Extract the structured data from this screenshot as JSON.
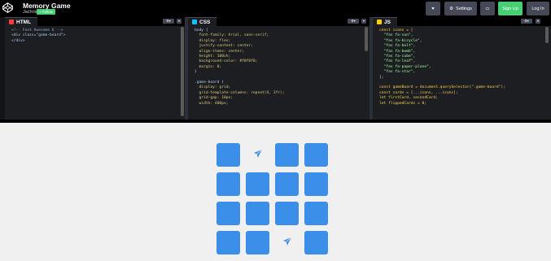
{
  "header": {
    "title": "Memory Game",
    "author": "Jachris Design",
    "follow_label": "+ Follow",
    "buttons": {
      "heart": "♥",
      "settings": "Settings",
      "layout": "▭",
      "signup": "Sign Up",
      "login": "Log In"
    }
  },
  "panels": {
    "html": {
      "label": "HTML",
      "color": "#ff3c41"
    },
    "css": {
      "label": "CSS",
      "color": "#0ebeff"
    },
    "js": {
      "label": "JS",
      "color": "#fcd000"
    }
  },
  "code": {
    "html": [
      "<!-- Font Awesome 6 -->",
      "<div class=\"game-board\">",
      "</div>"
    ],
    "css": [
      "body {",
      "  font-family: Arial, sans-serif;",
      "  display: flex;",
      "  justify-content: center;",
      "  align-items: center;",
      "  height: 100vh;",
      "  background-color: #f0f0f0;",
      "  margin: 0;",
      "}",
      "",
      ".game-board {",
      "  display: grid;",
      "  grid-template-columns: repeat(4, 1fr);",
      "  grid-gap: 10px;",
      "  width: 400px;"
    ],
    "js": [
      "const icons = [",
      "  \"fas fa-sun\",",
      "  \"fas fa-bicycle\",",
      "  \"fas fa-bolt\",",
      "  \"fas fa-bomb\",",
      "  \"fas fa-cube\",",
      "  \"fas fa-leaf\",",
      "  \"fas fa-paper-plane\",",
      "  \"fas fa-star\",",
      "];",
      "",
      "const gameBoard = document.querySelector(\".game-board\");",
      "const cards = [...icons, ...icons];",
      "let firstCard, secondCard;",
      "let flippedCards = 0;"
    ]
  },
  "board": {
    "rows": 4,
    "cols": 4,
    "card_color": "#3b8fe8",
    "revealed": [
      {
        "row": 0,
        "col": 1,
        "icon": "paper-plane-icon"
      },
      {
        "row": 3,
        "col": 2,
        "icon": "paper-plane-icon"
      }
    ]
  }
}
